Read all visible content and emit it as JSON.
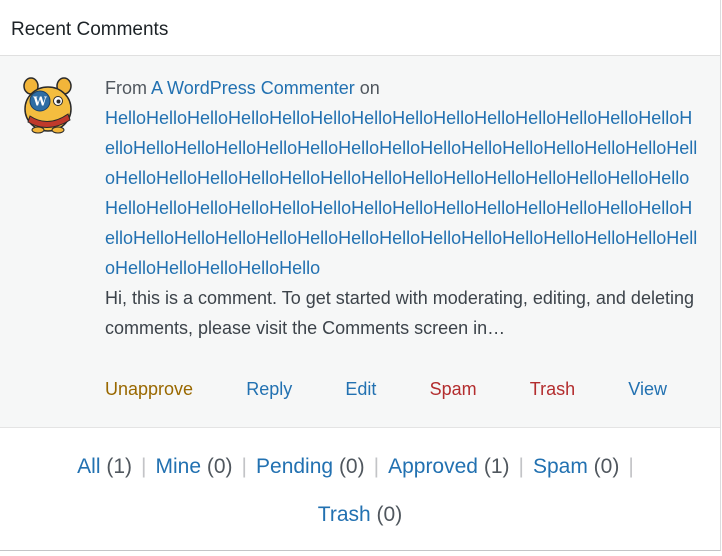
{
  "widget": {
    "title": "Recent Comments"
  },
  "comment": {
    "from_label": "From",
    "author": "A WordPress Commenter",
    "on_label": "on",
    "post_title": "HelloHelloHelloHelloHelloHelloHelloHelloHelloHelloHelloHelloHelloHelloHelloHelloHelloHelloHelloHelloHelloHelloHelloHelloHelloHelloHelloHelloHelloHelloHelloHelloHelloHelloHelloHelloHelloHelloHelloHelloHelloHelloHelloHelloHelloHelloHelloHelloHelloHelloHelloHelloHelloHelloHelloHelloHelloHelloHelloHelloHelloHelloHelloHelloHelloHelloHelloHelloHelloHelloHelloHelloHelloHelloHelloHelloHello",
    "excerpt": "Hi, this is a comment. To get started with moderating, editing, and deleting comments, please visit the Comments screen in…",
    "avatar_icon": "wapuu-avatar-icon"
  },
  "actions": {
    "unapprove": "Unapprove",
    "reply": "Reply",
    "edit": "Edit",
    "spam": "Spam",
    "trash": "Trash",
    "view": "View"
  },
  "filters": {
    "all": {
      "label": "All",
      "count": "(1)"
    },
    "mine": {
      "label": "Mine",
      "count": "(0)"
    },
    "pending": {
      "label": "Pending",
      "count": "(0)"
    },
    "approved": {
      "label": "Approved",
      "count": "(1)"
    },
    "spam": {
      "label": "Spam",
      "count": "(0)"
    },
    "trash": {
      "label": "Trash",
      "count": "(0)"
    },
    "separator": "|"
  },
  "colors": {
    "link": "#2271b1",
    "unapprove": "#996800",
    "danger": "#b32d2e",
    "panel_bg": "#f6f7f7"
  }
}
